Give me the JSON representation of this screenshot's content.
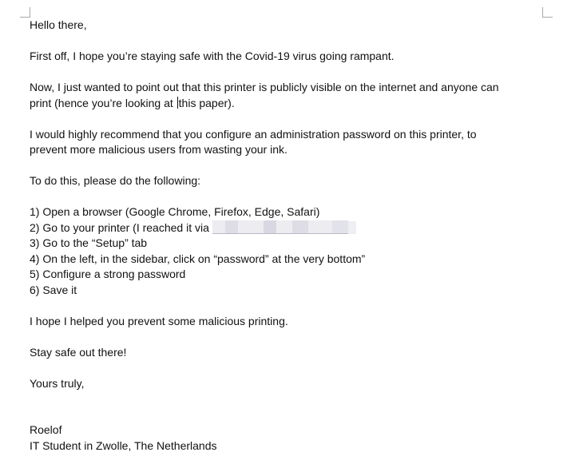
{
  "letter": {
    "greeting": "Hello there,",
    "p1": "First off, I hope you’re staying safe with the Covid-19 virus going rampant.",
    "p2_line1": "Now, I just wanted to point out that this printer is publicly visible on the internet and anyone can",
    "p2_line2_before_cursor": "print (hence you’re looking at ",
    "p2_line2_after_cursor": "this paper).",
    "p3_line1": "I would highly recommend that you configure an administration password on this printer, to",
    "p3_line2": "prevent more malicious users from wasting your ink.",
    "p4": "To do this, please do the following:",
    "steps": [
      "1) Open a browser (Google Chrome, Firefox, Edge, Safari)",
      "2) Go to your printer (I reached it via ",
      "3) Go to the “Setup” tab",
      "4) On the left, in the sidebar, click on “password” at the very bottom”",
      "5) Configure a strong password",
      "6) Save it"
    ],
    "p5": "I hope I helped you prevent some malicious printing.",
    "p6": "Stay safe out there!",
    "closing": "Yours truly,",
    "signature_name": "Roelof",
    "signature_title": "IT Student in Zwolle, The Netherlands"
  }
}
